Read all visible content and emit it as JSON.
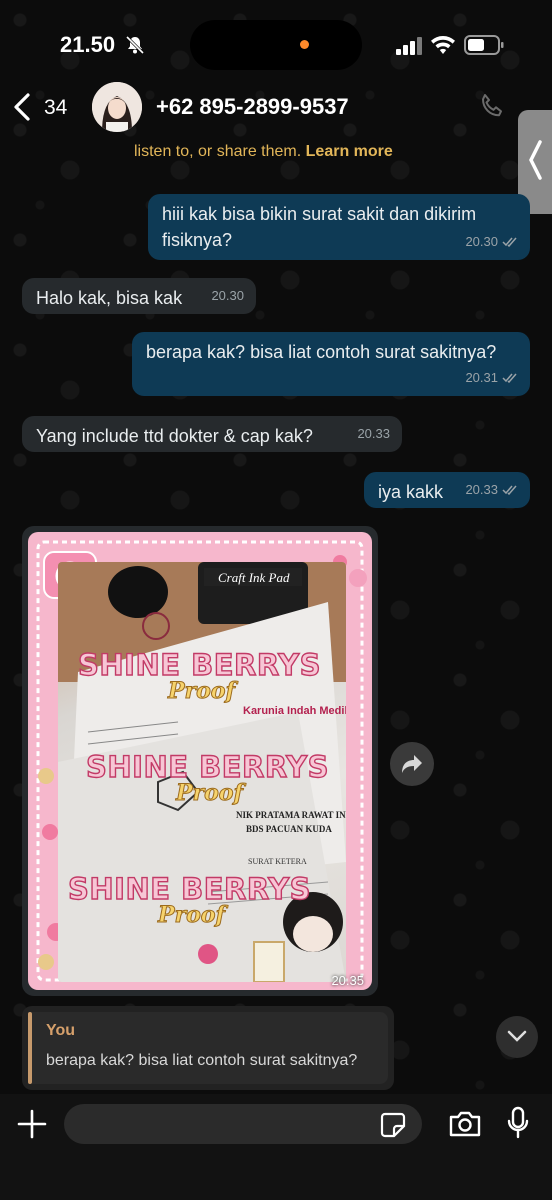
{
  "status_bar": {
    "time": "21.50"
  },
  "header": {
    "back_count": "34",
    "contact": "+62 895-2899-9537"
  },
  "notice": {
    "text": "listen to, or share them.",
    "link": "Learn more"
  },
  "messages": [
    {
      "dir": "out",
      "text": "hiii kak bisa bikin surat sakit dan dikirim fisiknya?",
      "time": "20.30"
    },
    {
      "dir": "in",
      "text": "Halo kak, bisa kak",
      "time": "20.30"
    },
    {
      "dir": "out",
      "text": "berapa kak? bisa liat contoh surat sakitnya?",
      "time": "20.31"
    },
    {
      "dir": "in",
      "text": "Yang include ttd dokter & cap kak?",
      "time": "20.33"
    },
    {
      "dir": "out",
      "text": "iya kakk",
      "time": "20.33"
    }
  ],
  "image_message": {
    "time": "20.35",
    "watermark_main": "SHINE BERRYS",
    "watermark_sub": "Proof",
    "doc_texts": [
      "Craft Ink Pad",
      "Karunia Indah Medika",
      "NIK PRATAMA RAWAT INAP",
      "BDS PACUAN KUDA",
      "SURAT KETERA"
    ]
  },
  "reply_preview": {
    "sender": "You",
    "text": "berapa kak? bisa liat contoh surat sakitnya?"
  },
  "colors": {
    "outgoing_bubble": "#0e3a55",
    "incoming_bubble": "#262a2d",
    "notice_text": "#e2b659",
    "reply_accent": "#d6a06b",
    "frame_pink": "#f6b7cc"
  }
}
